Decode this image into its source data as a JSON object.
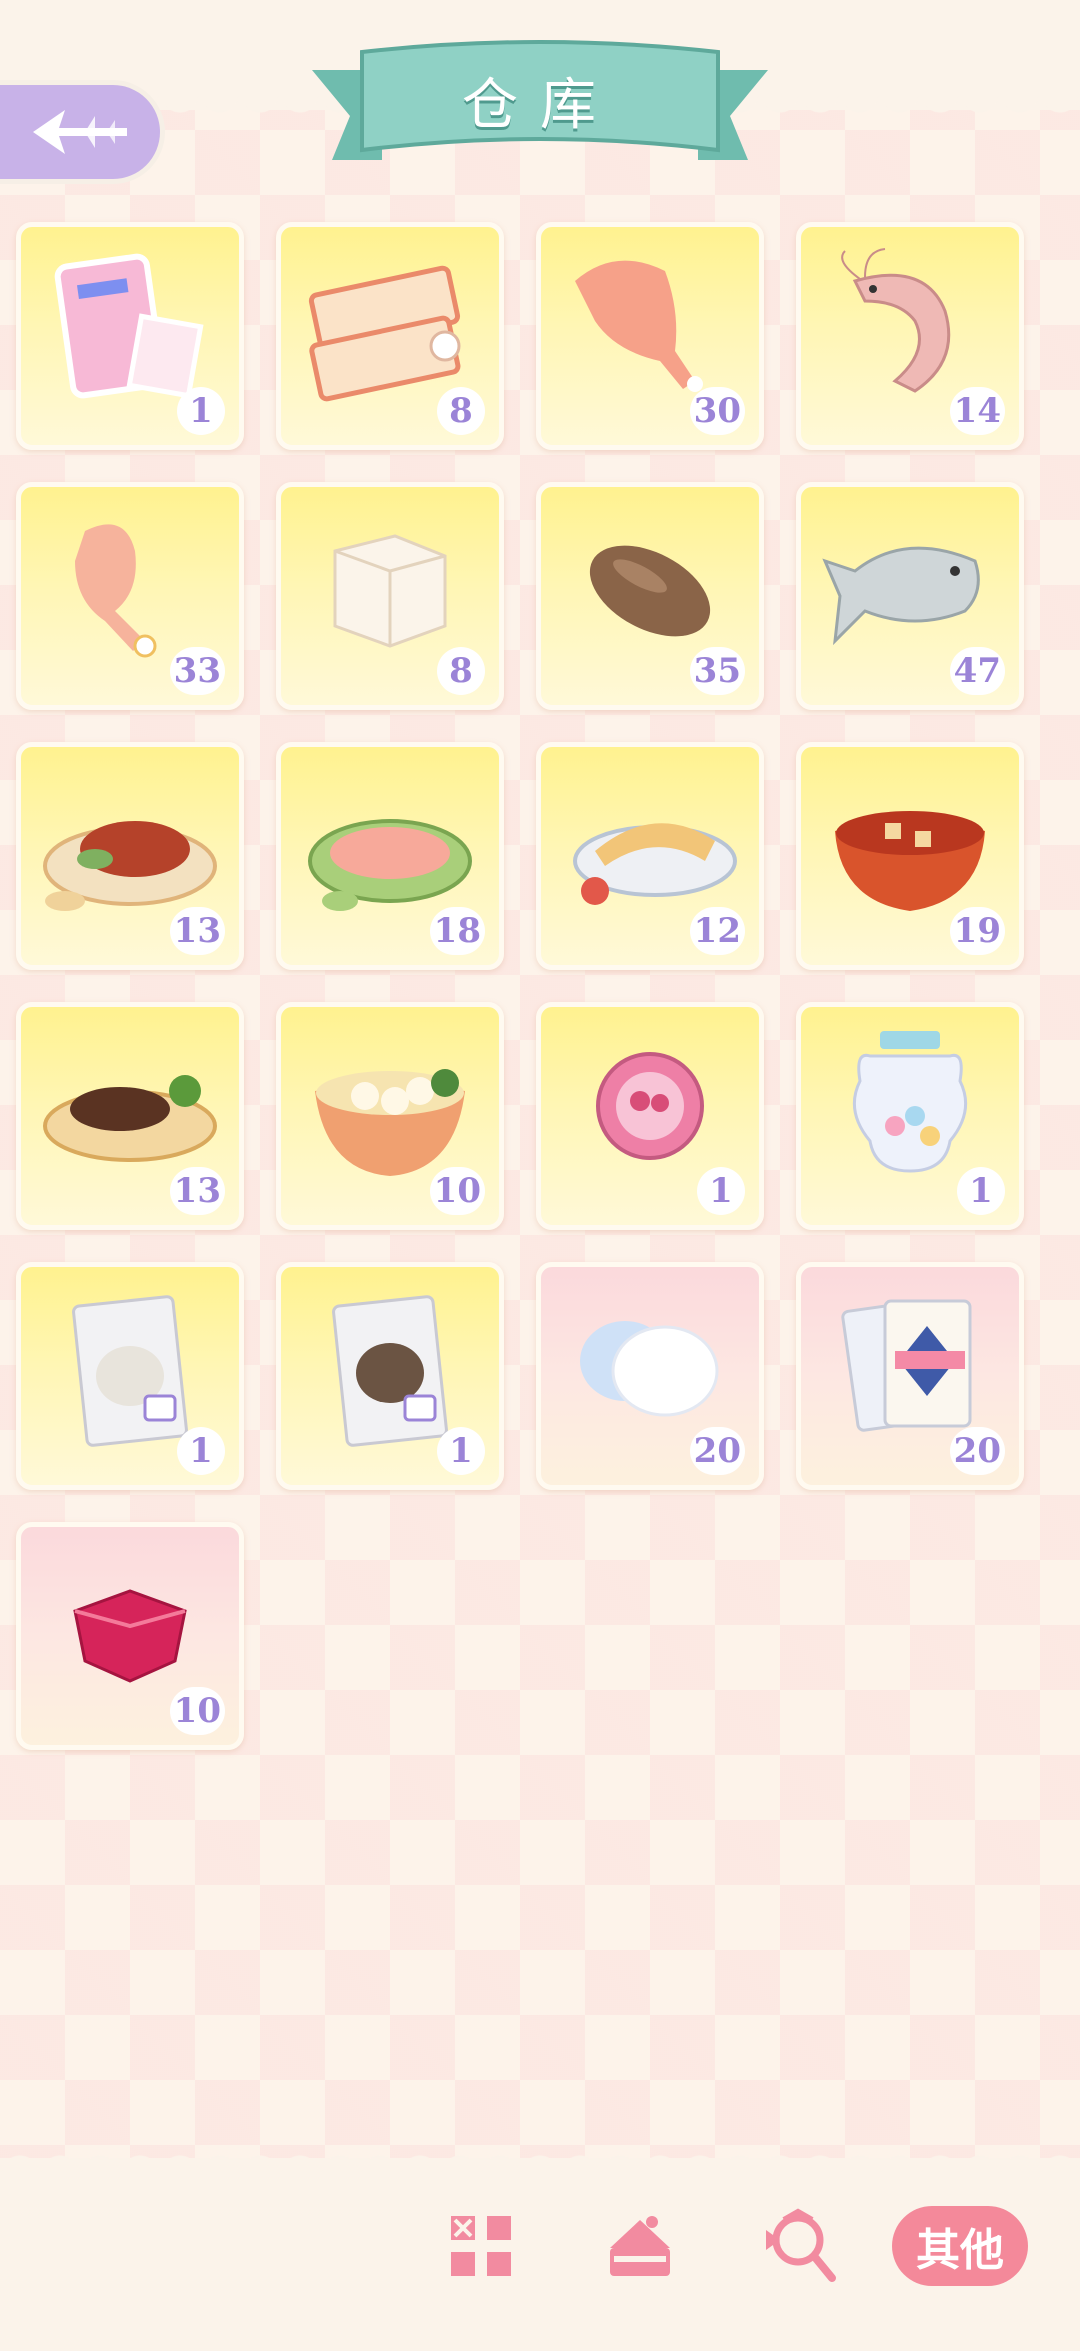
{
  "header": {
    "title": "仓库",
    "back_icon": "back-arrow-icon"
  },
  "items": [
    {
      "name": "photo-cards",
      "count": "1",
      "bg": "yellow"
    },
    {
      "name": "meal-tickets",
      "count": "8",
      "bg": "yellow"
    },
    {
      "name": "chicken-meat",
      "count": "30",
      "bg": "yellow"
    },
    {
      "name": "shrimp",
      "count": "14",
      "bg": "yellow"
    },
    {
      "name": "chicken-leg",
      "count": "33",
      "bg": "yellow"
    },
    {
      "name": "tofu",
      "count": "8",
      "bg": "yellow"
    },
    {
      "name": "sea-cucumber",
      "count": "35",
      "bg": "yellow"
    },
    {
      "name": "fish",
      "count": "47",
      "bg": "yellow"
    },
    {
      "name": "braised-pork-dish",
      "count": "13",
      "bg": "yellow"
    },
    {
      "name": "shrimp-dish",
      "count": "18",
      "bg": "yellow"
    },
    {
      "name": "sliced-chicken-dish",
      "count": "12",
      "bg": "yellow"
    },
    {
      "name": "mapo-tofu-dish",
      "count": "19",
      "bg": "yellow"
    },
    {
      "name": "braised-sea-cucumber-dish",
      "count": "13",
      "bg": "yellow"
    },
    {
      "name": "fish-ball-soup",
      "count": "10",
      "bg": "yellow"
    },
    {
      "name": "pink-badge",
      "count": "1",
      "bg": "yellow"
    },
    {
      "name": "candy-jar",
      "count": "1",
      "bg": "yellow"
    },
    {
      "name": "white-rice-bag",
      "count": "1",
      "bg": "yellow"
    },
    {
      "name": "dark-rice-bag",
      "count": "1",
      "bg": "yellow"
    },
    {
      "name": "cotton-cloud",
      "count": "20",
      "bg": "pink"
    },
    {
      "name": "playing-cards",
      "count": "20",
      "bg": "pink"
    },
    {
      "name": "red-gem",
      "count": "10",
      "bg": "pink"
    }
  ],
  "tabs": [
    {
      "name": "tab-items",
      "icon": "grid-icon"
    },
    {
      "name": "tab-cake",
      "icon": "cake-icon"
    },
    {
      "name": "tab-candy",
      "icon": "candy-icon"
    },
    {
      "name": "tab-other",
      "label": "其他",
      "active": true
    }
  ],
  "colors": {
    "accent": "#f4899a",
    "count_text": "#9b84d7",
    "ribbon": "#8fd1c5",
    "back_button": "#c8b2e8"
  }
}
